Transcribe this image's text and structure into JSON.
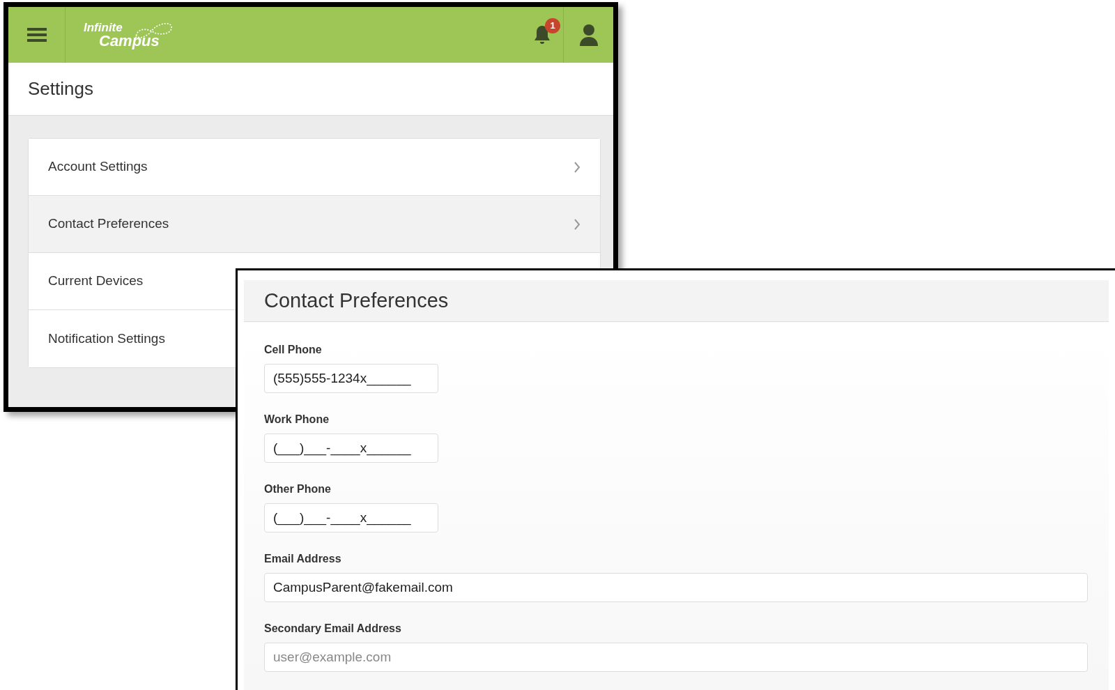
{
  "settings_window": {
    "logo": {
      "line_1": "Infinite",
      "line_2": "Campus"
    },
    "notification_badge": "1",
    "title": "Settings",
    "items": [
      {
        "label": "Account Settings",
        "selected": false,
        "chevron": true
      },
      {
        "label": "Contact Preferences",
        "selected": true,
        "chevron": true
      },
      {
        "label": "Current Devices",
        "selected": false,
        "chevron": false
      },
      {
        "label": "Notification Settings",
        "selected": false,
        "chevron": false
      }
    ]
  },
  "contact_preferences": {
    "title": "Contact Preferences",
    "fields": [
      {
        "label": "Cell Phone",
        "value": "(555)555-1234x______",
        "kind": "short"
      },
      {
        "label": "Work Phone",
        "value": "(___)___-____x______",
        "kind": "short"
      },
      {
        "label": "Other Phone",
        "value": "(___)___-____x______",
        "kind": "short"
      },
      {
        "label": "Email Address",
        "value": "CampusParent@fakemail.com",
        "kind": "wide"
      },
      {
        "label": "Secondary Email Address",
        "placeholder": "user@example.com",
        "kind": "wide"
      }
    ]
  }
}
